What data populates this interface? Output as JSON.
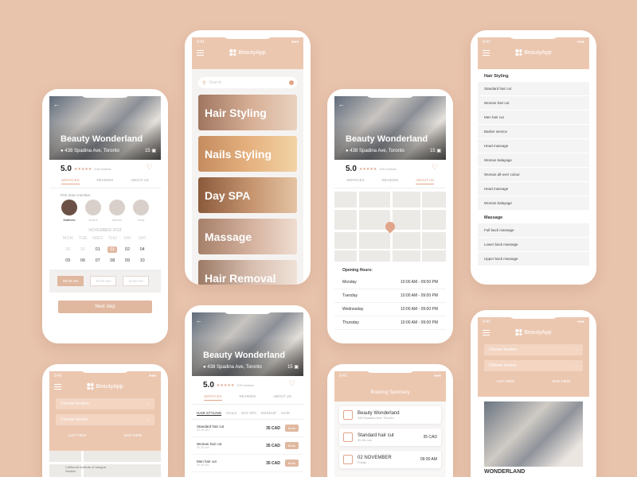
{
  "app": {
    "name": "BeautyApp",
    "time": "9:41"
  },
  "salon": {
    "name": "Beauty Wonderland",
    "address": "438 Spadina Ave, Toronto",
    "photo_count": "15",
    "rating": "5.0",
    "stars": "★★★★★",
    "reviews": "125 reviews"
  },
  "profile_tabs": [
    "SERVICES",
    "REVIEWS",
    "ABOUT US"
  ],
  "booking": {
    "expert_label": "Pick team member",
    "experts": [
      "Matthew",
      "Janine",
      "Martha",
      "Kelly"
    ],
    "month": "NOVEMBER 2018",
    "weekdays": [
      "MON",
      "TUE",
      "WED",
      "THU",
      "FRI",
      "SAT"
    ],
    "week1": [
      "30",
      "31",
      "01",
      "01",
      "02",
      "04"
    ],
    "week2": [
      "05",
      "06",
      "07",
      "08",
      "09",
      "10"
    ],
    "times": [
      "09:00 AM",
      "10:00 AM",
      "11:00 AM"
    ],
    "next_label": "Next step"
  },
  "home": {
    "search_placeholder": "Search",
    "categories": [
      "Hair Styling",
      "Nails Styling",
      "Day SPA",
      "Massage",
      "Hair Removal"
    ]
  },
  "about": {
    "hours_title": "Opening Hours:",
    "hours": [
      {
        "day": "Monday",
        "time": "10:00 AM - 09:00 PM"
      },
      {
        "day": "Tuesday",
        "time": "10:00 AM - 09:00 PM"
      },
      {
        "day": "Wednesday",
        "time": "10:00 AM - 09:00 PM"
      },
      {
        "day": "Thursday",
        "time": "10:00 AM - 09:00 PM"
      }
    ]
  },
  "services_list": {
    "hair_heading": "Hair Styling",
    "hair": [
      "Standard hair cut",
      "Woman hair cut",
      "Men hair cut",
      "Barber service",
      "Head massage",
      "Woman balayage",
      "Woman all-over colour",
      "Head massage",
      "Woman balayage"
    ],
    "massage_heading": "Massage",
    "massage": [
      "Full back massage",
      "Lower back massage",
      "Upper back massage"
    ]
  },
  "filters": {
    "location": "Choose location",
    "service": "Choose service",
    "list_view": "LIST VIEW",
    "map_view": "MAP VIEW"
  },
  "map_label": "California Institute of Integral Studies",
  "service_menu": {
    "tabs": [
      "HAIR STYLING",
      "NAILS",
      "DAY SPA",
      "MAKEUP",
      "HAIR"
    ],
    "items": [
      {
        "name": "Standard hair cut",
        "duration": "30-45 min",
        "price": "35 CAD"
      },
      {
        "name": "Woman hair cut",
        "duration": "30-45 min",
        "price": "35 CAD"
      },
      {
        "name": "Men hair cut",
        "duration": "30-45 min",
        "price": "35 CAD"
      }
    ],
    "book_label": "Book"
  },
  "summary": {
    "title": "Booking Summary",
    "salon": "Beauty Wonderland",
    "salon_addr": "438 Spadina Ave, Toronto",
    "service": "Standard hair cut",
    "service_dur": "30-45 min",
    "service_price": "35 CAD",
    "date": "02 NOVEMBER",
    "day": "Friday",
    "time": "09:30 AM"
  },
  "listing": {
    "name": "WONDERLAND"
  },
  "colors": {
    "background": "#e9c4ad",
    "accent": "#e0a58a",
    "peach": "#ecc7b0"
  }
}
